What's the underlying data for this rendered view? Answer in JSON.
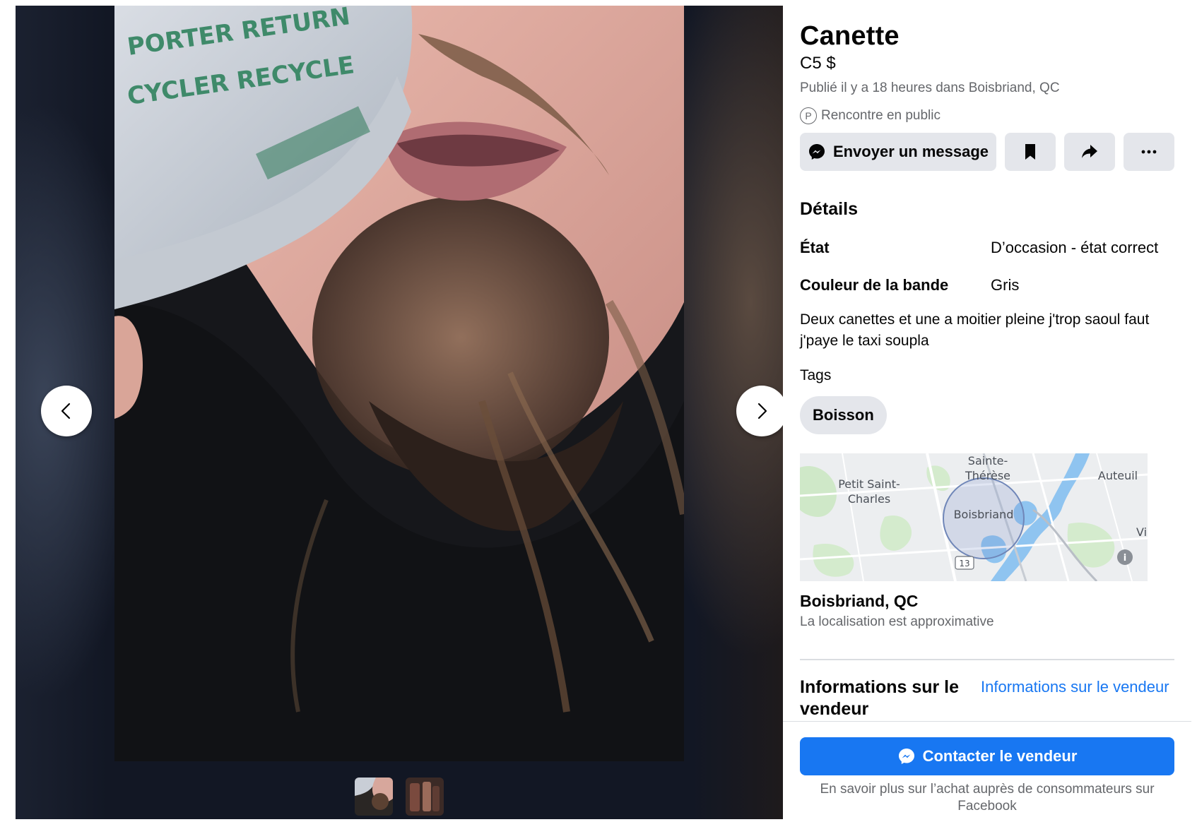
{
  "listing": {
    "title": "Canette",
    "price": "C5 $",
    "posted": "Publié il y a 18 heures dans Boisbriand, QC",
    "meet_public": "Rencontre en public",
    "meet_icon": "P"
  },
  "actions": {
    "message_label": "Envoyer un message",
    "save_icon": "bookmark-icon",
    "share_icon": "share-icon",
    "more_icon": "more-icon"
  },
  "details": {
    "heading": "Détails",
    "rows": [
      {
        "key": "État",
        "value": "D’occasion - état correct"
      },
      {
        "key": "Couleur de la bande",
        "value": "Gris"
      }
    ],
    "description": "Deux canettes et une a moitier pleine j'trop saoul faut j'paye le taxi soupla",
    "tags_label": "Tags",
    "tags": [
      "Boisson"
    ]
  },
  "map": {
    "labels": [
      "Sainte-",
      "Thérèse",
      "Petit Saint-",
      "Charles",
      "Auteuil",
      "Boisbriand",
      "Vi",
      "13"
    ]
  },
  "location": {
    "name": "Boisbriand, QC",
    "note": "La localisation est approximative"
  },
  "seller": {
    "heading": "Informations sur le vendeur",
    "link": "Informations sur le vendeur"
  },
  "footer": {
    "contact_label": "Contacter le vendeur",
    "learn_more": "En savoir plus sur l’achat auprès de consommateurs sur Facebook"
  },
  "colors": {
    "accent": "#1877f2",
    "button_grey": "#e4e6eb",
    "secondary_text": "#65676b"
  }
}
